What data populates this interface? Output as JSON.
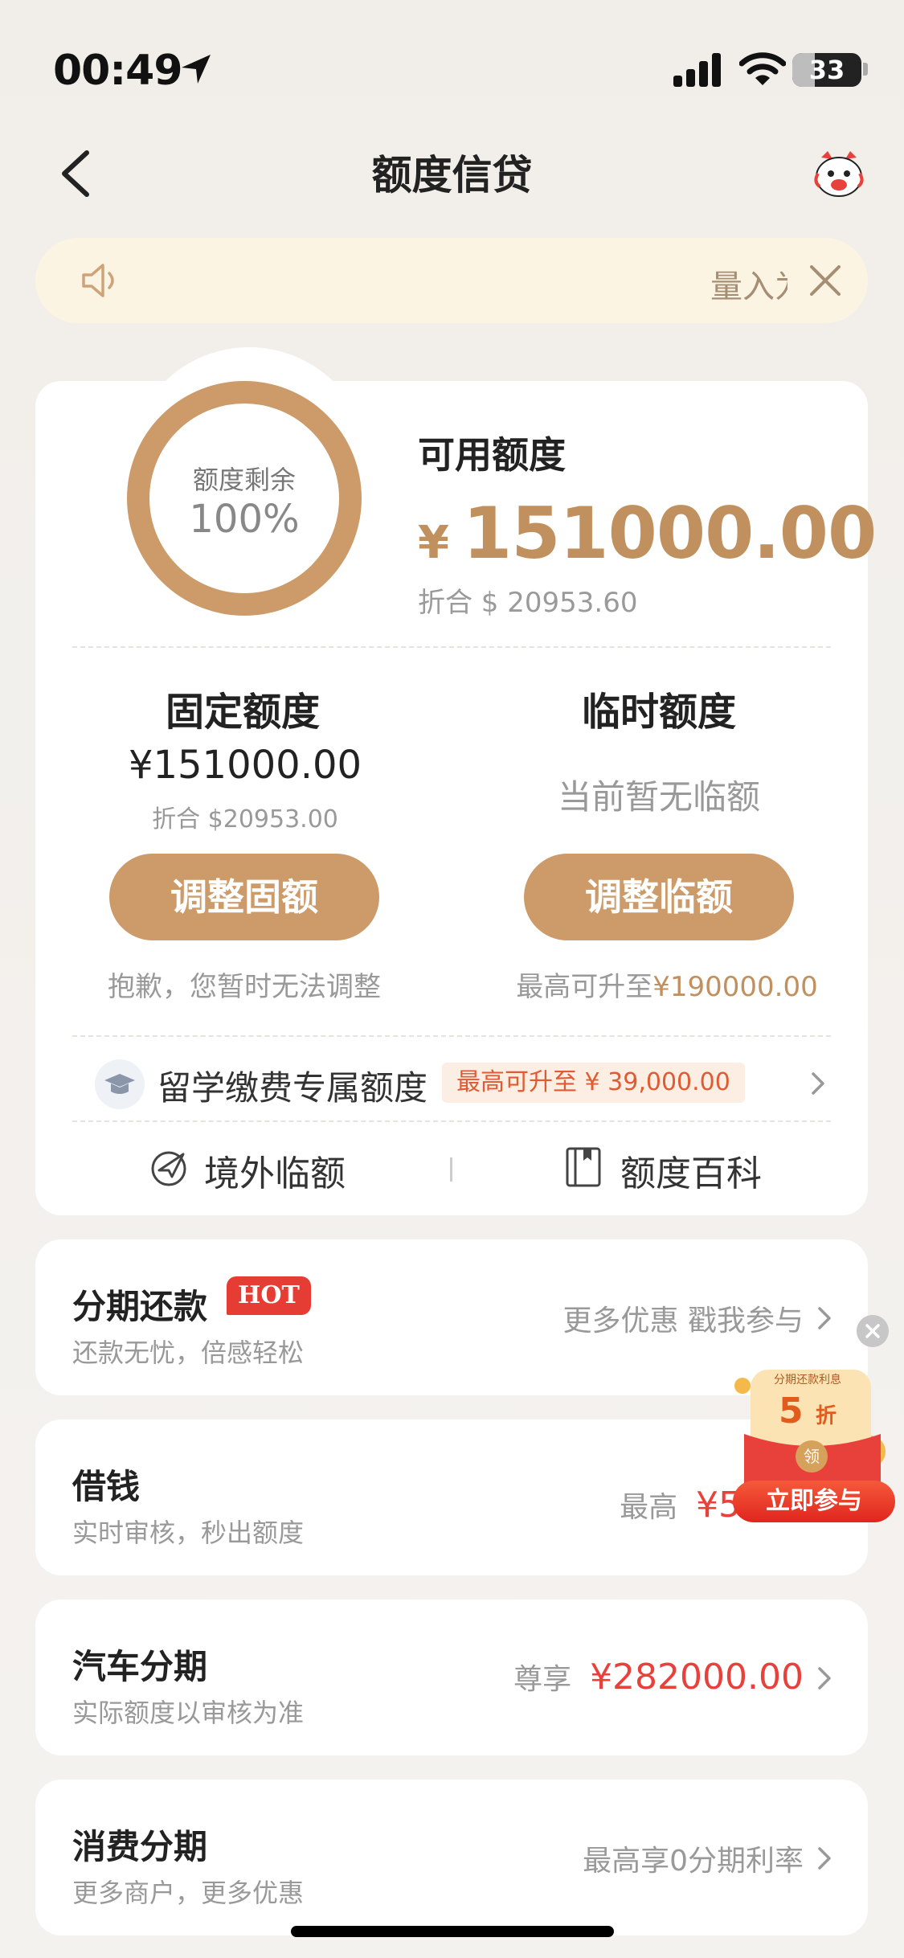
{
  "status_bar": {
    "time": "00:49",
    "battery": "33",
    "battery_level": 0.33
  },
  "nav": {
    "title": "额度信贷",
    "back_icon": "chevron-left-icon",
    "mascot_icon": "mascot-icon"
  },
  "notice": {
    "text": "量入为出",
    "speaker_icon": "speaker-icon",
    "close_icon": "close-icon"
  },
  "credit": {
    "ring_label": "额度剩余",
    "ring_percent": "100%",
    "ring_fraction": 1.0,
    "available_label": "可用额度",
    "currency_symbol": "¥",
    "available_amount": "151000.00",
    "available_converted": "折合 $ 20953.60",
    "fixed": {
      "title": "固定额度",
      "amount": "¥151000.00",
      "converted": "折合 $20953.00",
      "button": "调整固额",
      "note": "抱歉，您暂时无法调整"
    },
    "temporary": {
      "title": "临时额度",
      "status": "当前暂无临额",
      "button": "调整临额",
      "note_prefix": "最高可升至",
      "note_amount": "¥190000.00"
    },
    "study": {
      "label": "留学缴费专属额度",
      "badge": "最高可升至 ¥ 39,000.00",
      "icon": "graduation-cap-icon"
    },
    "links": {
      "overseas": "境外临额",
      "encyclopedia": "额度百科"
    }
  },
  "services": [
    {
      "title": "分期还款",
      "badge": "HOT",
      "subtitle": "还款无忧，倍感轻松",
      "right_text": "更多优惠 戳我参与",
      "right_value": ""
    },
    {
      "title": "借钱",
      "subtitle": "实时审核，秒出额度",
      "right_text": "最高",
      "right_value": "¥50"
    },
    {
      "title": "汽车分期",
      "subtitle": "实际额度以审核为准",
      "right_text": "尊享",
      "right_value": "¥282000.00"
    },
    {
      "title": "消费分期",
      "subtitle": "更多商户，更多优惠",
      "right_text": "最高享0分期利率",
      "right_value": ""
    }
  ],
  "promo": {
    "tag": "分期还款利息",
    "discount": "5",
    "discount_unit": "折",
    "receive": "领",
    "button": "立即参与"
  },
  "colors": {
    "gold": "#cc9b69",
    "gold_text": "#c1905f",
    "red": "#e8413b",
    "notice_bg": "#fcf4e2"
  }
}
